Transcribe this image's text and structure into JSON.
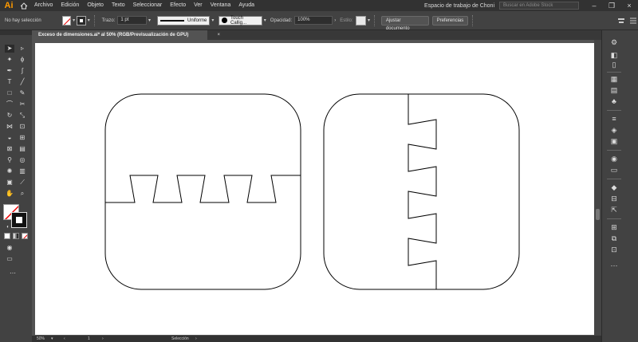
{
  "app": {
    "logo": "Ai"
  },
  "menu": [
    "Archivo",
    "Edición",
    "Objeto",
    "Texto",
    "Seleccionar",
    "Efecto",
    "Ver",
    "Ventana",
    "Ayuda"
  ],
  "workspace": "Espacio de trabajo de Choni",
  "search": {
    "placeholder": "Buscar en Adobe Stock"
  },
  "controlbar": {
    "selection_status": "No hay selección",
    "stroke_label": "Trazo:",
    "stroke_weight": "1 pt",
    "profile": "Uniforme",
    "brush": "Touch Callig...",
    "opacity_label": "Opacidad:",
    "opacity_value": "100%",
    "style_label": "Estilo:",
    "arrange_button": "Ajustar documento",
    "prefs_button": "Preferencias"
  },
  "document": {
    "tab_title": "Exceso de dimensiones.ai* al 50% (RGB/Previsualización de GPU)",
    "close": "×"
  },
  "statusbar": {
    "zoom": "50%",
    "page": "1",
    "tool": "Selección"
  },
  "colors": {
    "ui_dark": "#323232",
    "ui_mid": "#424242",
    "canvas_bg": "#535353",
    "artboard": "#ffffff",
    "stroke": "#000000",
    "brand": "#ff9a00"
  },
  "icons": {
    "home": "home-icon",
    "minimize": "minimize-icon",
    "restore": "restore-icon",
    "close": "close-icon"
  }
}
